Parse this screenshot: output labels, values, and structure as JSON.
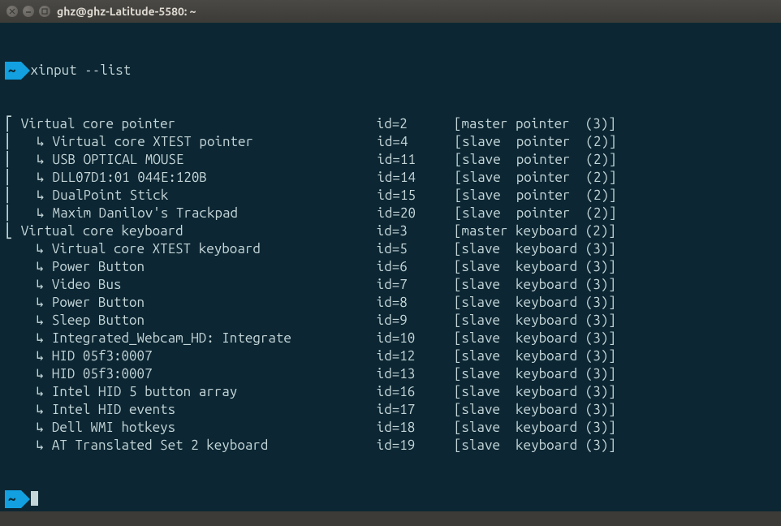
{
  "window": {
    "title": "ghz@ghz-Latitude-5580: ~"
  },
  "prompt": {
    "symbol": "~",
    "command": "xinput --list"
  },
  "output": {
    "groups": [
      {
        "tree_prefix": "⎡ ",
        "name": "Virtual core pointer",
        "id": "id=2",
        "bracket": "[master pointer  (3)]",
        "children": [
          {
            "tree_prefix": "⎜   ↳ ",
            "name": "Virtual core XTEST pointer",
            "id": "id=4",
            "bracket": "[slave  pointer  (2)]"
          },
          {
            "tree_prefix": "⎜   ↳ ",
            "name": "USB OPTICAL MOUSE",
            "id": "id=11",
            "bracket": "[slave  pointer  (2)]"
          },
          {
            "tree_prefix": "⎜   ↳ ",
            "name": "DLL07D1:01 044E:120B",
            "id": "id=14",
            "bracket": "[slave  pointer  (2)]"
          },
          {
            "tree_prefix": "⎜   ↳ ",
            "name": "DualPoint Stick",
            "id": "id=15",
            "bracket": "[slave  pointer  (2)]"
          },
          {
            "tree_prefix": "⎜   ↳ ",
            "name": "Maxim Danilov's Trackpad",
            "id": "id=20",
            "bracket": "[slave  pointer  (2)]"
          }
        ]
      },
      {
        "tree_prefix": "⎣ ",
        "name": "Virtual core keyboard",
        "id": "id=3",
        "bracket": "[master keyboard (2)]",
        "children": [
          {
            "tree_prefix": "    ↳ ",
            "name": "Virtual core XTEST keyboard",
            "id": "id=5",
            "bracket": "[slave  keyboard (3)]"
          },
          {
            "tree_prefix": "    ↳ ",
            "name": "Power Button",
            "id": "id=6",
            "bracket": "[slave  keyboard (3)]"
          },
          {
            "tree_prefix": "    ↳ ",
            "name": "Video Bus",
            "id": "id=7",
            "bracket": "[slave  keyboard (3)]"
          },
          {
            "tree_prefix": "    ↳ ",
            "name": "Power Button",
            "id": "id=8",
            "bracket": "[slave  keyboard (3)]"
          },
          {
            "tree_prefix": "    ↳ ",
            "name": "Sleep Button",
            "id": "id=9",
            "bracket": "[slave  keyboard (3)]"
          },
          {
            "tree_prefix": "    ↳ ",
            "name": "Integrated_Webcam_HD: Integrate",
            "id": "id=10",
            "bracket": "[slave  keyboard (3)]"
          },
          {
            "tree_prefix": "    ↳ ",
            "name": "HID 05f3:0007",
            "id": "id=12",
            "bracket": "[slave  keyboard (3)]"
          },
          {
            "tree_prefix": "    ↳ ",
            "name": "HID 05f3:0007",
            "id": "id=13",
            "bracket": "[slave  keyboard (3)]"
          },
          {
            "tree_prefix": "    ↳ ",
            "name": "Intel HID 5 button array",
            "id": "id=16",
            "bracket": "[slave  keyboard (3)]"
          },
          {
            "tree_prefix": "    ↳ ",
            "name": "Intel HID events",
            "id": "id=17",
            "bracket": "[slave  keyboard (3)]"
          },
          {
            "tree_prefix": "    ↳ ",
            "name": "Dell WMI hotkeys",
            "id": "id=18",
            "bracket": "[slave  keyboard (3)]"
          },
          {
            "tree_prefix": "    ↳ ",
            "name": "AT Translated Set 2 keyboard",
            "id": "id=19",
            "bracket": "[slave  keyboard (3)]"
          }
        ]
      }
    ]
  },
  "columns": {
    "name_width": 46,
    "id_width": 10
  }
}
